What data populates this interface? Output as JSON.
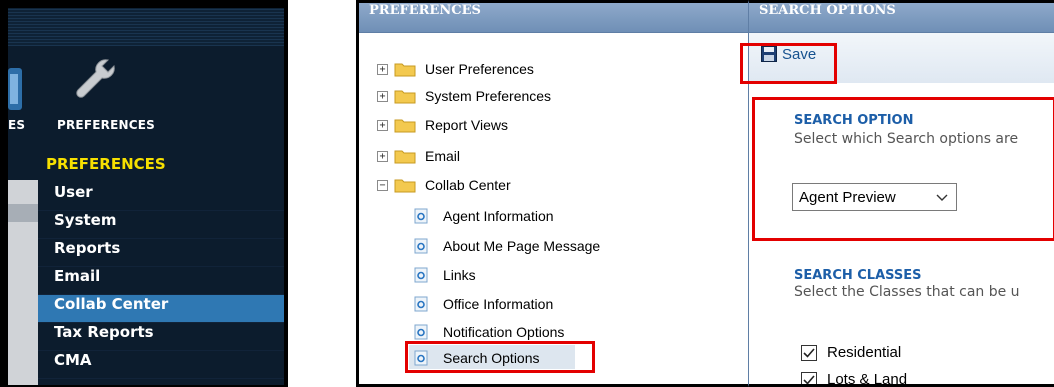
{
  "left_nav": {
    "top_label_cut": "ES",
    "top_label": "PREFERENCES",
    "heading": "PREFERENCES",
    "items": [
      {
        "label": "User"
      },
      {
        "label": "System"
      },
      {
        "label": "Reports"
      },
      {
        "label": "Email"
      },
      {
        "label": "Collab Center",
        "active": true
      },
      {
        "label": "Tax Reports"
      },
      {
        "label": "CMA"
      }
    ]
  },
  "tree_panel": {
    "header": "PREFERENCES",
    "folders": [
      {
        "label": "User Preferences",
        "expander": "+"
      },
      {
        "label": "System Preferences",
        "expander": "+"
      },
      {
        "label": "Report Views",
        "expander": "+"
      },
      {
        "label": "Email",
        "expander": "+"
      },
      {
        "label": "Collab Center",
        "expander": "−"
      }
    ],
    "children": [
      {
        "label": "Agent Information"
      },
      {
        "label": "About Me Page Message"
      },
      {
        "label": "Links"
      },
      {
        "label": "Office Information"
      },
      {
        "label": "Notification Options"
      },
      {
        "label": "Search Options",
        "selected": true
      }
    ]
  },
  "options_panel": {
    "header": "SEARCH OPTIONS",
    "save_label": "Save",
    "search_option": {
      "title": "SEARCH OPTION",
      "description": "Select which Search options are",
      "selected_value": "Agent Preview"
    },
    "search_classes": {
      "title": "SEARCH CLASSES",
      "description": "Select the Classes that can be u",
      "checkboxes": [
        {
          "label": "Residential",
          "checked": true
        },
        {
          "label": "Lots & Land",
          "checked": true
        }
      ]
    }
  },
  "colors": {
    "highlight": "#e30000",
    "active_nav": "#2f78b3",
    "heading_yellow": "#f7e000",
    "section_blue": "#1c5ea8"
  },
  "icons": [
    "wrench-icon",
    "folder-icon",
    "page-icon",
    "save-icon",
    "chevron-down-icon",
    "checkmark-icon"
  ]
}
